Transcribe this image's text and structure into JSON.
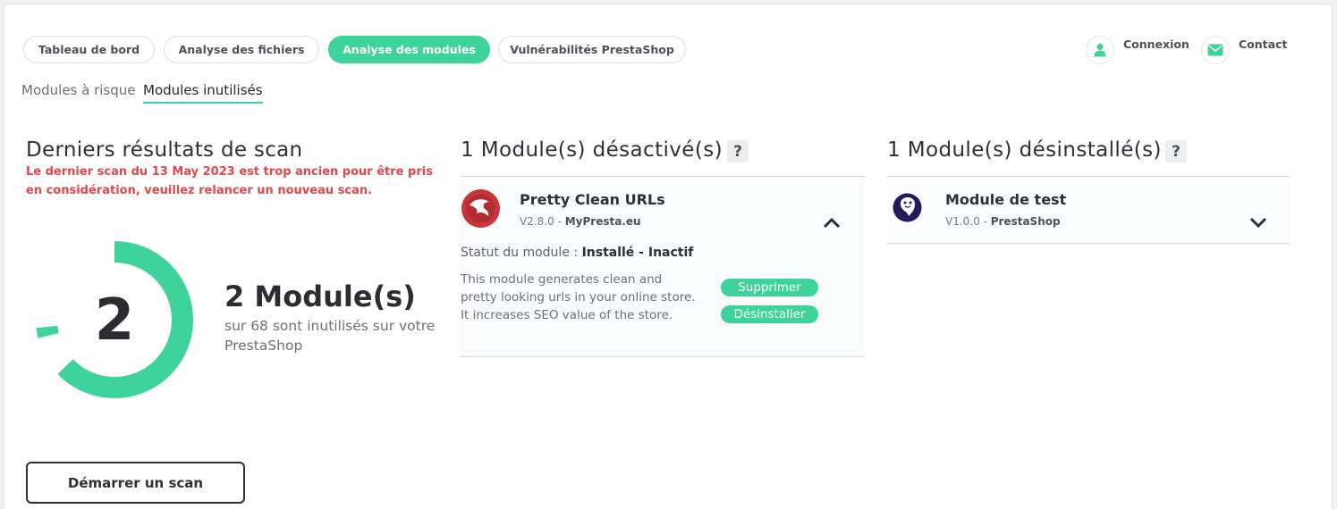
{
  "nav": {
    "tabs": [
      {
        "label": "Tableau de bord"
      },
      {
        "label": "Analyse des fichiers"
      },
      {
        "label": "Analyse des modules"
      },
      {
        "label": "Vulnérabilités PrestaShop"
      }
    ],
    "login_label": "Connexion",
    "contact_label": "Contact"
  },
  "subtabs": [
    {
      "label": "Modules à risque"
    },
    {
      "label": "Modules inutilisés"
    }
  ],
  "scan": {
    "title": "Derniers résultats de scan",
    "warning": "Le dernier scan du 13 May 2023 est trop ancien pour être pris en considération, veuillez relancer un nouveau scan.",
    "gauge_value": "2",
    "count_label": "2 Module(s)",
    "count_sub": "sur 68 sont inutilisés sur votre PrestaShop",
    "start_button": "Démarrer un scan"
  },
  "disabled": {
    "title": "1 Module(s) désactivé(s)",
    "help": "?",
    "module": {
      "name": "Pretty Clean URLs",
      "version": "V2.8.0",
      "sep": " - ",
      "author": "MyPresta.eu",
      "status_label": "Statut du module : ",
      "status_value": "Installé - Inactif",
      "description": "This module generates clean and pretty looking urls in your online store. It increases SEO value of the store.",
      "delete_button": "Supprimer",
      "uninstall_button": "Désinstaller"
    }
  },
  "uninstalled": {
    "title": "1 Module(s) désinstallé(s)",
    "help": "?",
    "module": {
      "name": "Module de test",
      "version": "V1.0.0",
      "sep": " - ",
      "author": "PrestaShop"
    }
  },
  "colors": {
    "accent": "#3ed39a",
    "warning": "#e4464f"
  }
}
